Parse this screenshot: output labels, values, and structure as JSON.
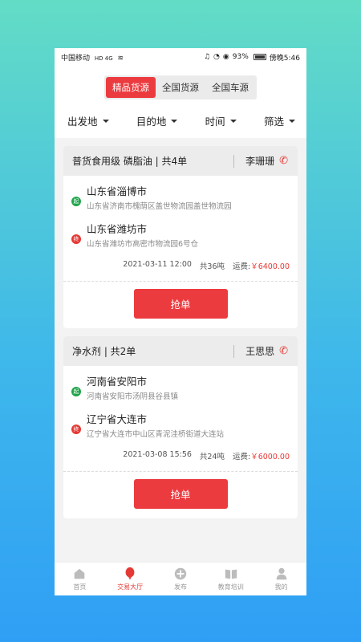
{
  "status_bar": {
    "carrier": "中国移动",
    "network": "HD 4G",
    "battery_percent": "93%",
    "time": "傍晚5:46"
  },
  "segment_tabs": [
    {
      "label": "精品货源",
      "active": true
    },
    {
      "label": "全国货源",
      "active": false
    },
    {
      "label": "全国车源",
      "active": false
    }
  ],
  "filters": [
    {
      "label": "出发地"
    },
    {
      "label": "目的地"
    },
    {
      "label": "时间"
    },
    {
      "label": "筛选"
    }
  ],
  "cards": [
    {
      "title": "普货食用级 磷脂油 | 共4单",
      "contact": "李珊珊",
      "start_badge": "起",
      "start_city": "山东省淄博市",
      "start_address": "山东省济南市槐荫区盖世物流园盖世物流园",
      "end_badge": "终",
      "end_city": "山东省潍坊市",
      "end_address": "山东省潍坊市高密市物流园6号仓",
      "datetime": "2021-03-11 12:00",
      "weight": "共36吨",
      "fee_label": "运费:",
      "fee_value": "￥6400.00",
      "button": "抢单"
    },
    {
      "title": "净水剂 | 共2单",
      "contact": "王思思",
      "start_badge": "起",
      "start_city": "河南省安阳市",
      "start_address": "河南省安阳市汤阴县谷县镇",
      "end_badge": "终",
      "end_city": "辽宁省大连市",
      "end_address": "辽宁省大连市中山区青泥洼桥街道大连站",
      "datetime": "2021-03-08 15:56",
      "weight": "共24吨",
      "fee_label": "运费:",
      "fee_value": "￥6000.00",
      "button": "抢单"
    }
  ],
  "tab_bar": [
    {
      "label": "首页",
      "icon": "home-icon",
      "active": false
    },
    {
      "label": "交易大厅",
      "icon": "balloon-icon",
      "active": true
    },
    {
      "label": "发布",
      "icon": "plus-circle-icon",
      "active": false
    },
    {
      "label": "教育培训",
      "icon": "book-icon",
      "active": false
    },
    {
      "label": "我的",
      "icon": "user-icon",
      "active": false
    }
  ],
  "colors": {
    "accent": "#ec3b3f",
    "start_badge": "#22a54c",
    "end_badge": "#e53935"
  }
}
